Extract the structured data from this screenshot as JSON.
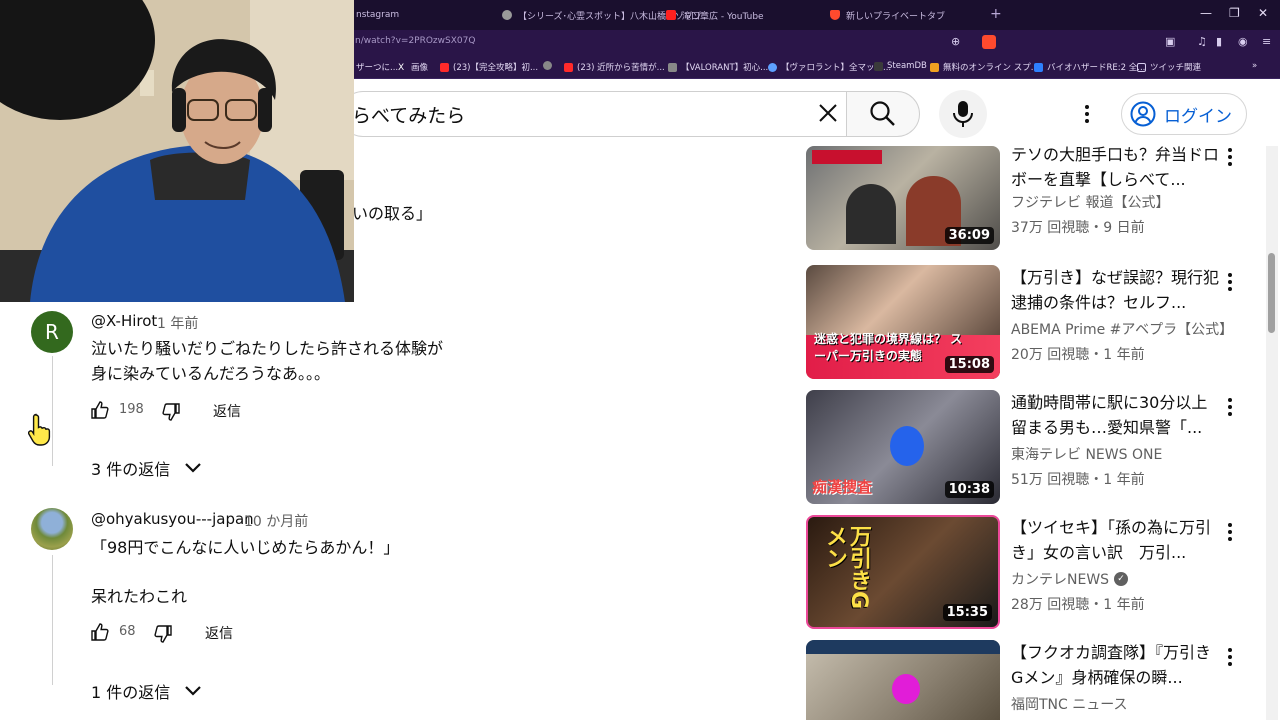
{
  "browser": {
    "tabs": [
      {
        "label": "nstagram",
        "color": "#c9bce0"
      },
      {
        "label": "【シリーズ･心霊スポット】八木山橋｜ゾゾゾ",
        "color": "#9a9a9a"
      },
      {
        "label": "滝口章広 - YouTube",
        "color": "#ff2020"
      },
      {
        "label": "新しいプライベートタブ",
        "color": "#ff4a2e"
      }
    ],
    "new_tab": "+",
    "url": "n/watch?v=2PROzwSX07Q",
    "bookmarks": [
      {
        "label": "ザーつに...",
        "color": "#7f6aa8"
      },
      {
        "label": "画像",
        "color": "#ffffff"
      },
      {
        "label": "(23)【完全攻略】初...",
        "color": "#ff2a2a"
      },
      {
        "label": "(23) 近所から苦情が...",
        "color": "#ff2a2a"
      },
      {
        "label": "【VALORANT】初心...",
        "color": "#888888"
      },
      {
        "label": "【ヴァロラント】全マップ...",
        "color": "#5ea0ff"
      },
      {
        "label": "SteamDB",
        "color": "#3a3a3a"
      },
      {
        "label": "無料のオンライン スプ...",
        "color": "#f0a020"
      },
      {
        "label": "バイオハザードRE:2 全...",
        "color": "#2e80ff"
      },
      {
        "label": "ツイッチ関連",
        "color": "#d8cdee"
      }
    ]
  },
  "header": {
    "search_value": "らべてみたら",
    "login_label": "ログイン"
  },
  "partial_comment": "いの取る」",
  "comments": [
    {
      "avatar_letter": "R",
      "handle": "@X-Hirot",
      "time": "1 年前",
      "lines": [
        "泣いたり騒いだりごねたりしたら許される体験が",
        "身に染みているんだろうなあ。。。"
      ],
      "likes": "198",
      "reply_label": "返信",
      "replies_label": "3 件の返信"
    },
    {
      "handle": "@ohyakusyou---japan",
      "time": "10 か月前",
      "lines": [
        "「98円でこんなに人いじめたらあかん！」",
        "",
        "呆れたわこれ"
      ],
      "likes": "68",
      "reply_label": "返信",
      "replies_label": "1 件の返信"
    }
  ],
  "recommended": [
    {
      "title": "テソの大胆手口も？弁当ドロボーを直撃【しらべて...",
      "channel": "フジテレビ 報道【公式】",
      "meta": "37万 回視聴・9 日前",
      "duration": "36:09",
      "verified": false
    },
    {
      "title": "【万引き】なぜ誤認？現行犯逮捕の条件は？セルフ...",
      "channel": "ABEMA Prime #アベプラ【公式】",
      "meta": "20万 回視聴・1 年前",
      "duration": "15:08",
      "verified": false,
      "thumb_text": "迷惑と犯罪の境界線は？ スーパー万引きの実態"
    },
    {
      "title": "通勤時間帯に駅に30分以上留まる男も…愛知県警「...",
      "channel": "東海テレビ NEWS ONE",
      "meta": "51万 回視聴・1 年前",
      "duration": "10:38",
      "verified": false,
      "thumb_text": "痴漢捜査"
    },
    {
      "title": "【ツイセキ】「孫の為に万引き」女の言い訳　万引...",
      "channel": "カンテレNEWS",
      "meta": "28万 回視聴・1 年前",
      "duration": "15:35",
      "verified": true,
      "thumb_text": "万引きGメン"
    },
    {
      "title": "【フクオカ調査隊】『万引きGメン』身柄確保の瞬...",
      "channel": "福岡TNC ニュース",
      "meta": "",
      "duration": "",
      "verified": false
    }
  ]
}
